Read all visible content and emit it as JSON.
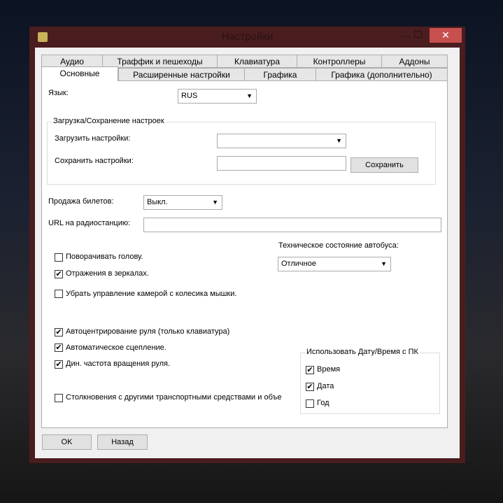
{
  "window": {
    "title": "Настройки",
    "close": "✕",
    "minimize": "—"
  },
  "tabs_row1": [
    "Аудио",
    "Траффик и пешеходы",
    "Клавиатура",
    "Контроллеры",
    "Аддоны"
  ],
  "tabs_row2": [
    "Основные",
    "Расширенные настройки",
    "Графика",
    "Графика (дополнительно)"
  ],
  "language": {
    "label": "Язык:",
    "value": "RUS"
  },
  "load_save": {
    "title": "Загрузка/Сохранение настроек",
    "load_label": "Загрузить настройки:",
    "load_value": "",
    "save_label": "Сохранить настройки:",
    "save_value": "",
    "save_button": "Сохранить"
  },
  "tickets": {
    "label": "Продажа билетов:",
    "value": "Выкл."
  },
  "radio": {
    "label": "URL на радиостанцию:",
    "value": ""
  },
  "bus_state": {
    "label": "Техническое состояние автобуса:",
    "value": "Отличное"
  },
  "checkboxes": [
    {
      "label": "Поворачивать голову.",
      "checked": false
    },
    {
      "label": "Отражения в зеркалах.",
      "checked": true
    },
    {
      "label": "Убрать управление камерой с колесика мышки.",
      "checked": false
    },
    {
      "label": "Автоцентрирование руля (только клавиатура)",
      "checked": true
    },
    {
      "label": "Автоматическое сцепление.",
      "checked": true
    },
    {
      "label": "Дин. частота вращения руля.",
      "checked": true
    },
    {
      "label": "Столкновения с другими транспортными средствами и объе",
      "checked": false
    }
  ],
  "datetime": {
    "title": "Использовать Дату/Время с ПК",
    "items": [
      {
        "label": "Время",
        "checked": true
      },
      {
        "label": "Дата",
        "checked": true
      },
      {
        "label": "Год",
        "checked": false
      }
    ]
  },
  "footer": {
    "ok": "OK",
    "back": "Назад"
  }
}
